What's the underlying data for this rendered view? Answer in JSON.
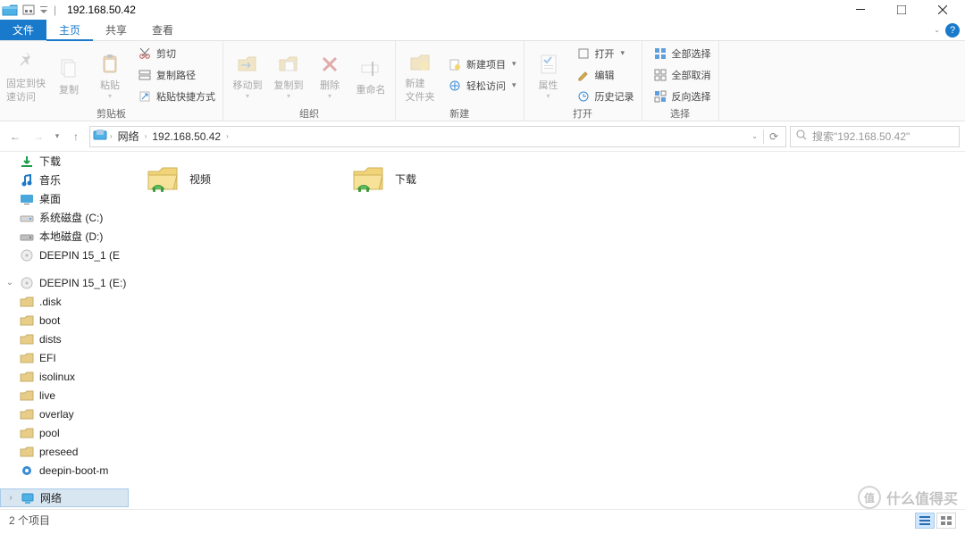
{
  "titlebar": {
    "title": "192.168.50.42"
  },
  "tabs": {
    "file": "文件",
    "home": "主页",
    "share": "共享",
    "view": "查看"
  },
  "ribbon": {
    "clipboard": {
      "pin": "固定到快\n速访问",
      "copy": "复制",
      "paste": "粘贴",
      "cut": "剪切",
      "copy_path": "复制路径",
      "paste_shortcut": "粘贴快捷方式",
      "label": "剪贴板"
    },
    "organize": {
      "move_to": "移动到",
      "copy_to": "复制到",
      "delete": "删除",
      "rename": "重命名",
      "label": "组织"
    },
    "new": {
      "new_folder": "新建\n文件夹",
      "new_item": "新建项目",
      "easy_access": "轻松访问",
      "label": "新建"
    },
    "open": {
      "properties": "属性",
      "open": "打开",
      "edit": "编辑",
      "history": "历史记录",
      "label": "打开"
    },
    "select": {
      "select_all": "全部选择",
      "select_none": "全部取消",
      "invert": "反向选择",
      "label": "选择"
    }
  },
  "address": {
    "crumb1": "网络",
    "crumb2": "192.168.50.42"
  },
  "search": {
    "placeholder": "搜索\"192.168.50.42\""
  },
  "nav": {
    "items": [
      {
        "label": "下载",
        "icon": "download",
        "indent": 22
      },
      {
        "label": "音乐",
        "icon": "music",
        "indent": 22
      },
      {
        "label": "桌面",
        "icon": "desktop",
        "indent": 22
      },
      {
        "label": "系统磁盘 (C:)",
        "icon": "drive",
        "indent": 22
      },
      {
        "label": "本地磁盘 (D:)",
        "icon": "drive2",
        "indent": 22
      },
      {
        "label": "DEEPIN 15_1 (E",
        "icon": "disc",
        "indent": 22
      },
      {
        "label": "DEEPIN 15_1 (E:)",
        "icon": "disc",
        "indent": 6,
        "expand": "open"
      },
      {
        "label": ".disk",
        "icon": "folder",
        "indent": 22
      },
      {
        "label": "boot",
        "icon": "folder",
        "indent": 22
      },
      {
        "label": "dists",
        "icon": "folder",
        "indent": 22
      },
      {
        "label": "EFI",
        "icon": "folder",
        "indent": 22
      },
      {
        "label": "isolinux",
        "icon": "folder",
        "indent": 22
      },
      {
        "label": "live",
        "icon": "folder",
        "indent": 22
      },
      {
        "label": "overlay",
        "icon": "folder",
        "indent": 22
      },
      {
        "label": "pool",
        "icon": "folder",
        "indent": 22
      },
      {
        "label": "preseed",
        "icon": "folder",
        "indent": 22
      },
      {
        "label": "deepin-boot-m",
        "icon": "gear",
        "indent": 22
      },
      {
        "label": "网络",
        "icon": "network",
        "indent": 6,
        "expand": "closed",
        "selected": true
      }
    ]
  },
  "content": {
    "items": [
      {
        "label": "视频"
      },
      {
        "label": "下载"
      }
    ]
  },
  "status": {
    "count": "2 个项目"
  },
  "watermark": "什么值得买"
}
